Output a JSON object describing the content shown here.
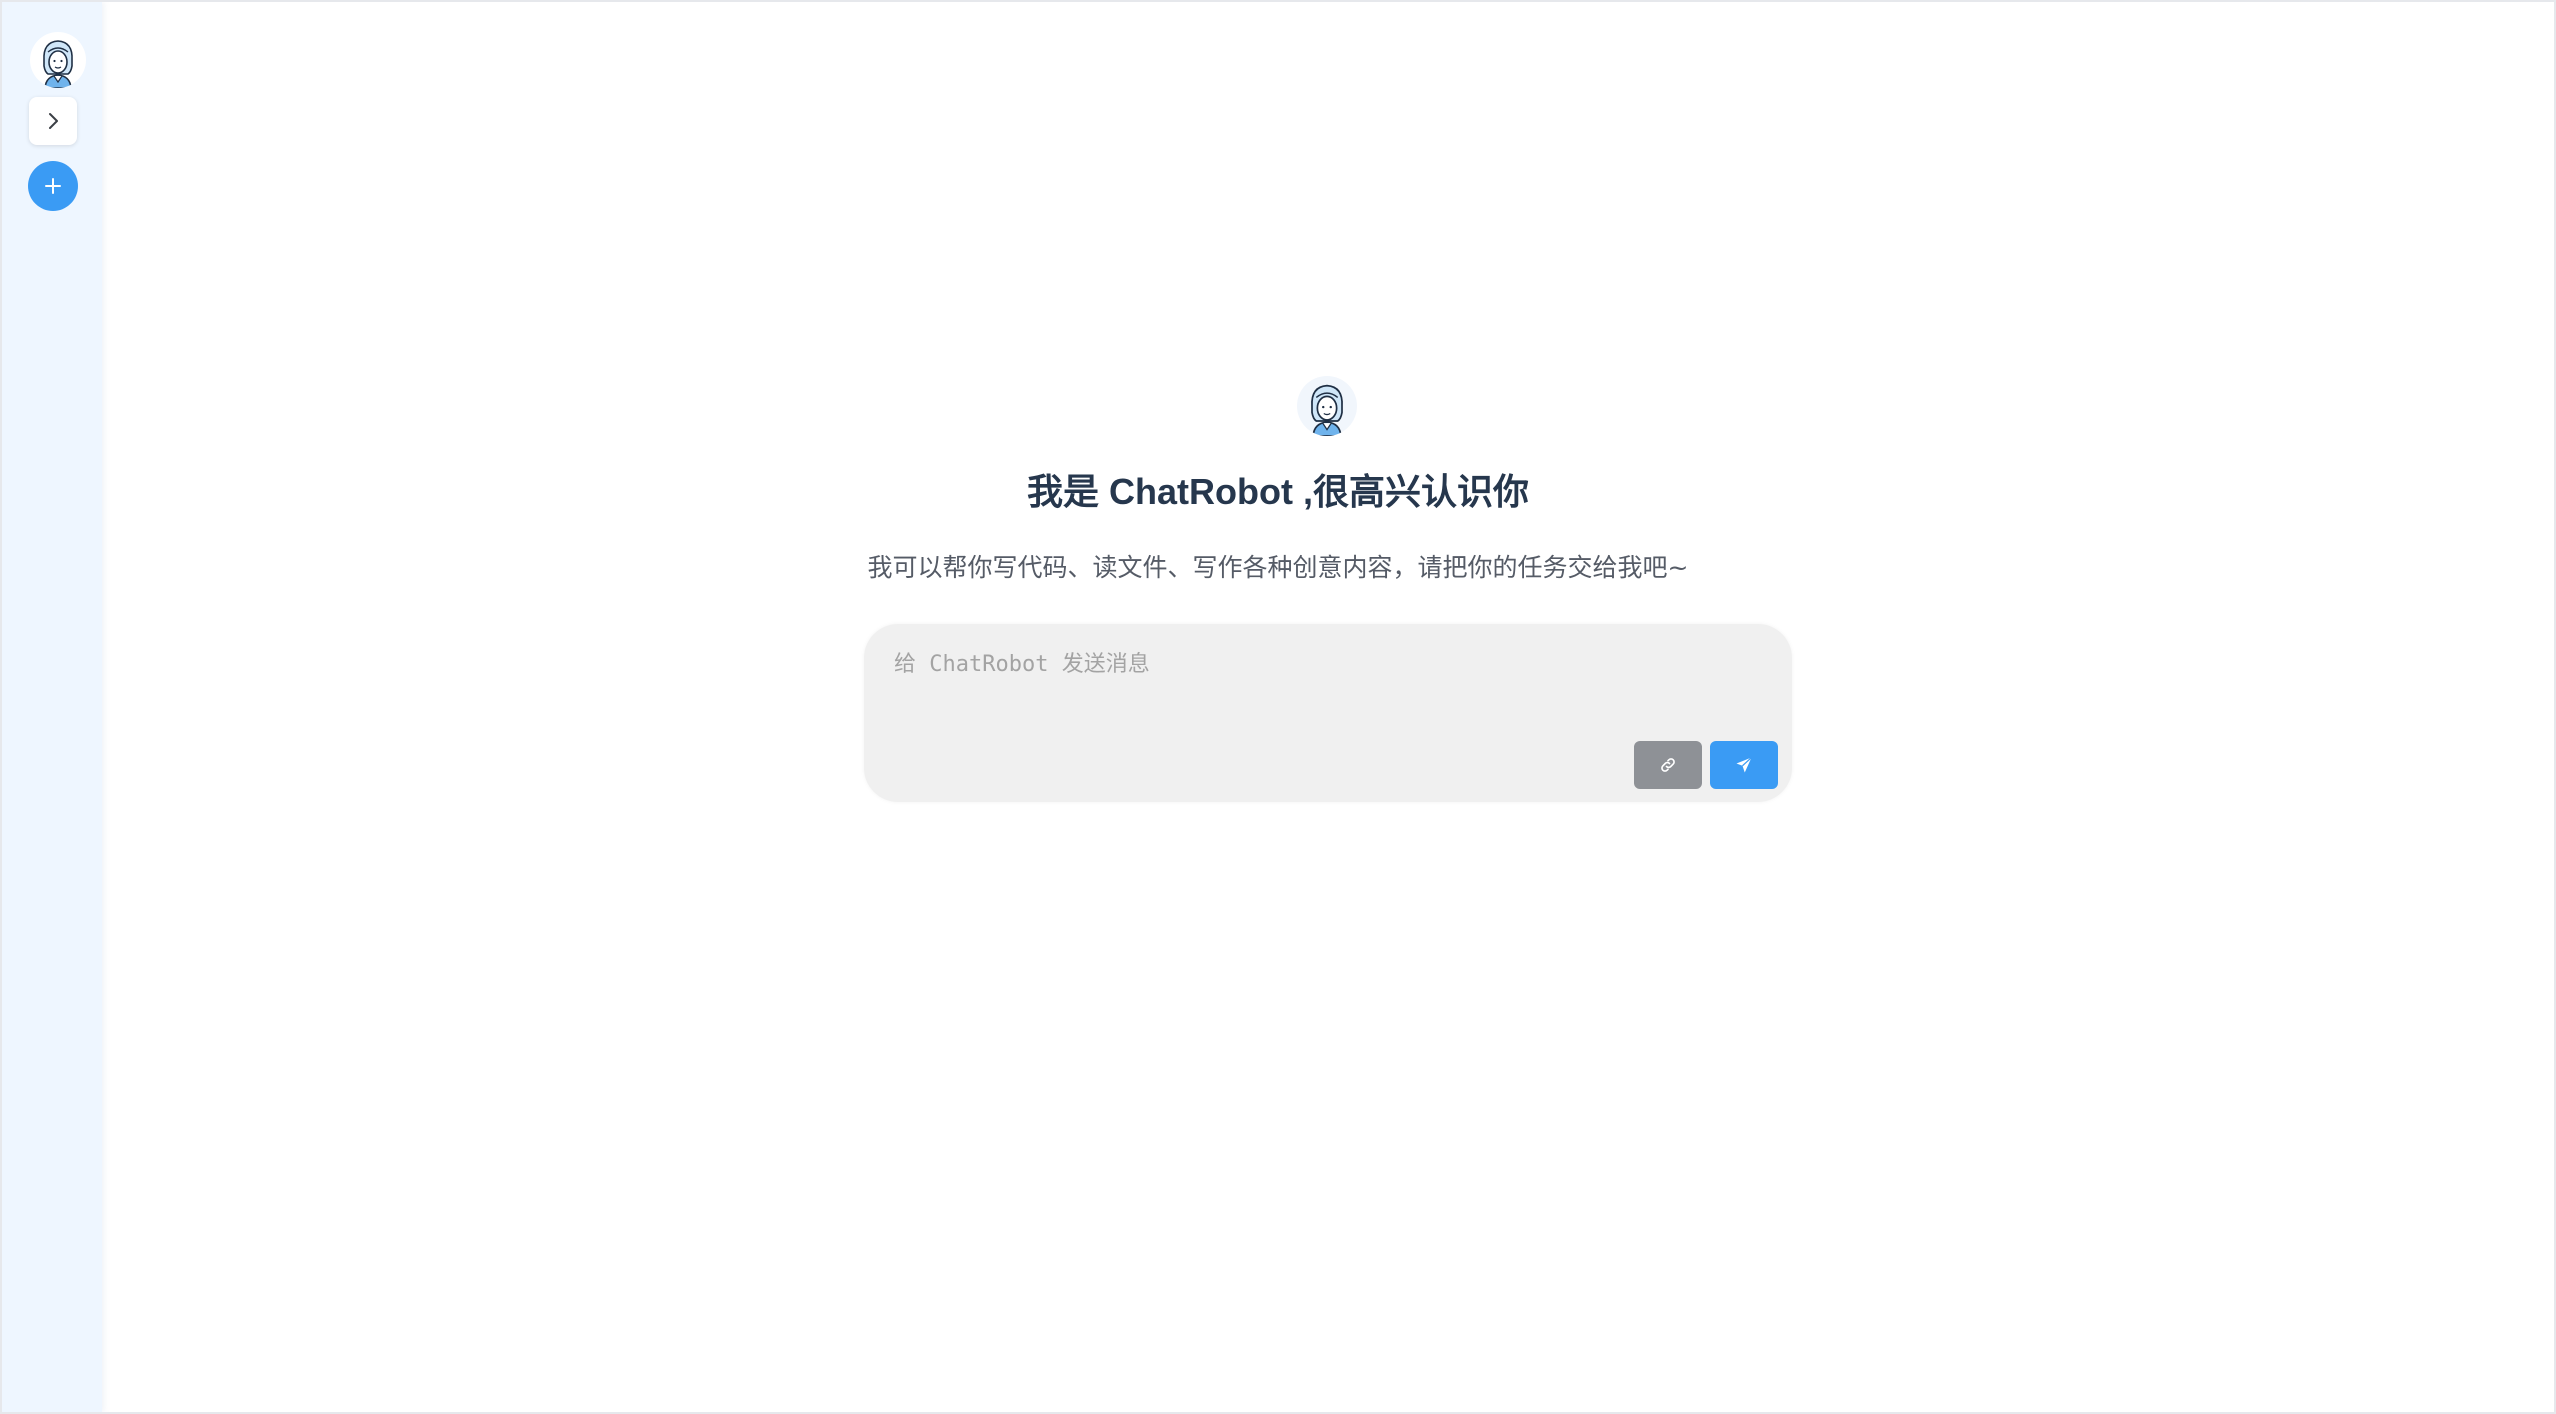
{
  "app": {
    "brand_color": "#3a9bf4"
  },
  "sidebar": {
    "avatar_icon": "robot-avatar-icon",
    "toggle_icon": "chevron-right-icon",
    "new_chat_icon": "plus-icon"
  },
  "welcome": {
    "avatar_icon": "robot-avatar-icon",
    "title": "我是 ChatRobot ,很高兴认识你",
    "subtitle": "我可以帮你写代码、读文件、写作各种创意内容，请把你的任务交给我吧~"
  },
  "composer": {
    "placeholder": "给 ChatRobot 发送消息",
    "value": "",
    "attach_icon": "link-icon",
    "send_icon": "send-plane-icon"
  }
}
